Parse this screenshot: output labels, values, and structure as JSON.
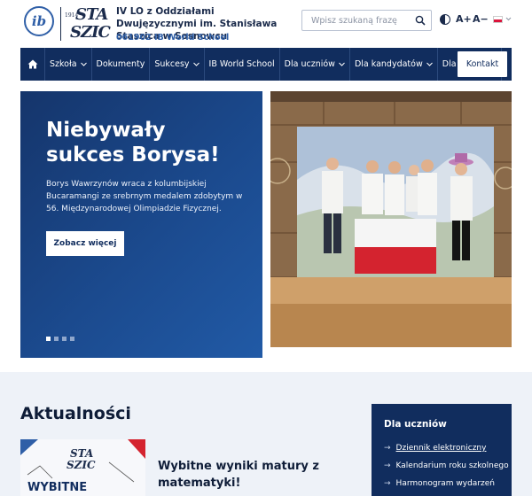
{
  "header": {
    "ib_logo_text": "ib",
    "staszic_logo": {
      "year": "1914",
      "line1": "STA",
      "line2": "SZIC"
    },
    "school_name": "IV LO z Oddziałami Dwujęzycznymi im. Stanisława Staszica w Sosnowcu",
    "school_code": "061902 IB World School",
    "search": {
      "placeholder": "Wpisz szukaną frazę"
    },
    "accessibility": {
      "font_increase": "A+",
      "font_decrease": "A−"
    }
  },
  "nav": {
    "items": [
      {
        "label": "Szkoła",
        "has_dropdown": true
      },
      {
        "label": "Dokumenty",
        "has_dropdown": false
      },
      {
        "label": "Sukcesy",
        "has_dropdown": true
      },
      {
        "label": "IB World School",
        "has_dropdown": false
      },
      {
        "label": "Dla uczniów",
        "has_dropdown": true
      },
      {
        "label": "Dla kandydatów",
        "has_dropdown": true
      },
      {
        "label": "Dla rodziców",
        "has_dropdown": false
      }
    ],
    "contact_label": "Kontakt"
  },
  "hero": {
    "title": "Niebywały sukces Borysa!",
    "text": "Borys Wawrzynów wraca z kolumbijskiej Bucaramangi ze srebrnym medalem zdobytym w 56. Międzynarodowej Olimpiadzie Fizycznej.",
    "button_label": "Zobacz więcej",
    "slides_count": 4,
    "active_slide": 1
  },
  "news": {
    "section_title": "Aktualności",
    "items": [
      {
        "headline": "Wybitne wyniki matury z matematyki!",
        "thumb_text": "WYBITNE"
      }
    ]
  },
  "students_box": {
    "title": "Dla uczniów",
    "links": [
      {
        "label": "Dziennik elektroniczny",
        "underlined": true
      },
      {
        "label": "Kalendarium roku szkolnego",
        "underlined": false
      },
      {
        "label": "Harmonogram wydarzeń",
        "underlined": false
      }
    ]
  },
  "colors": {
    "navy": "#112d5e",
    "ib_blue": "#2f5fa7",
    "lower_bg": "#eef2f8",
    "flag_red": "#dc143c"
  }
}
